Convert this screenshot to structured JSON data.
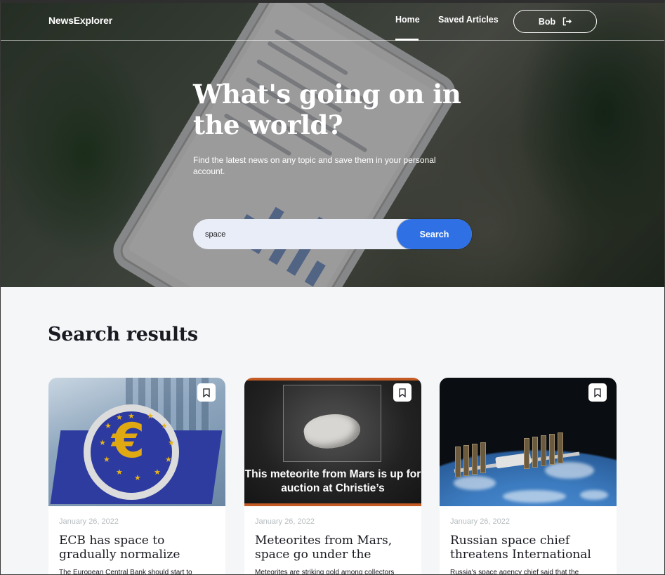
{
  "header": {
    "logo": "NewsExplorer",
    "nav": {
      "home": "Home",
      "saved": "Saved Articles"
    },
    "user": {
      "name": "Bob"
    }
  },
  "hero": {
    "title": "What's going on in the world?",
    "subtitle": "Find the latest news on any topic and save them in your personal account.",
    "search": {
      "value": "space",
      "button": "Search"
    }
  },
  "results": {
    "title": "Search results",
    "cards": [
      {
        "date": "January 26, 2022",
        "title": "ECB has space to gradually normalize",
        "text": "The European Central Bank should start to"
      },
      {
        "date": "January 26, 2022",
        "title": "Meteorites from Mars, space go under the",
        "text": "Meteorites are striking gold among collectors",
        "image_caption": "This meteorite from Mars is up for auction at Christie’s"
      },
      {
        "date": "January 26, 2022",
        "title": "Russian space chief threatens International",
        "text": "Russia's space agency chief said that the"
      }
    ]
  },
  "colors": {
    "accent": "#2f71e5",
    "text": "#1a1b22",
    "muted": "#b6bcbf",
    "page_bg": "#f5f6f7"
  }
}
